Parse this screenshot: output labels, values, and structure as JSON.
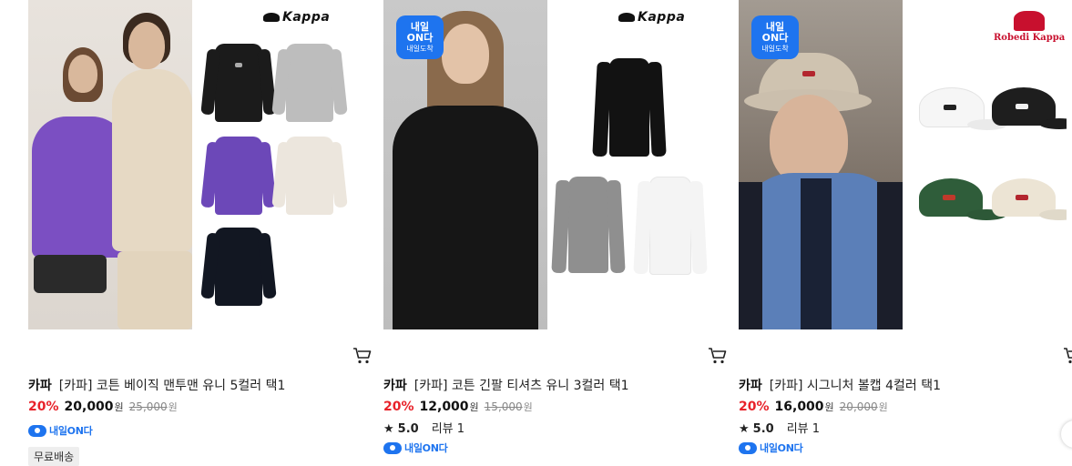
{
  "products": [
    {
      "brand": "카파",
      "name": "[카파] 코튼 베이직 맨투맨 유니 5컬러 택1",
      "discount": "20%",
      "price": "20,000",
      "price_unit": "원",
      "original_price": "25,000",
      "original_unit": "원",
      "delivery_badge": "내일ON다",
      "tag": "무료배송",
      "brand_logo": "Kappa"
    },
    {
      "brand": "카파",
      "name": "[카파] 코튼 긴팔 티셔츠 유니 3컬러 택1",
      "discount": "20%",
      "price": "12,000",
      "price_unit": "원",
      "original_price": "15,000",
      "original_unit": "원",
      "rating": "5.0",
      "review": "리뷰 1",
      "delivery_badge": "내일ON다",
      "badge": {
        "line1": "내일",
        "line2": "ON다",
        "line3": "내일도착"
      },
      "brand_logo": "Kappa"
    },
    {
      "brand": "카파",
      "name": "[카파] 시그니처 볼캡 4컬러 택1",
      "discount": "20%",
      "price": "16,000",
      "price_unit": "원",
      "original_price": "20,000",
      "original_unit": "원",
      "rating": "5.0",
      "review": "리뷰 1",
      "delivery_badge": "내일ON다",
      "badge": {
        "line1": "내일",
        "line2": "ON다",
        "line3": "내일도착"
      },
      "brand_logo_line1": "Robe",
      "brand_logo_line2": "di Kappa"
    }
  ],
  "colors": {
    "discount": "#e8222a",
    "delivery_blue": "#1e74ef"
  },
  "icons": {
    "cart": "cart-icon",
    "star": "star-icon",
    "truck": "delivery-truck-icon"
  }
}
